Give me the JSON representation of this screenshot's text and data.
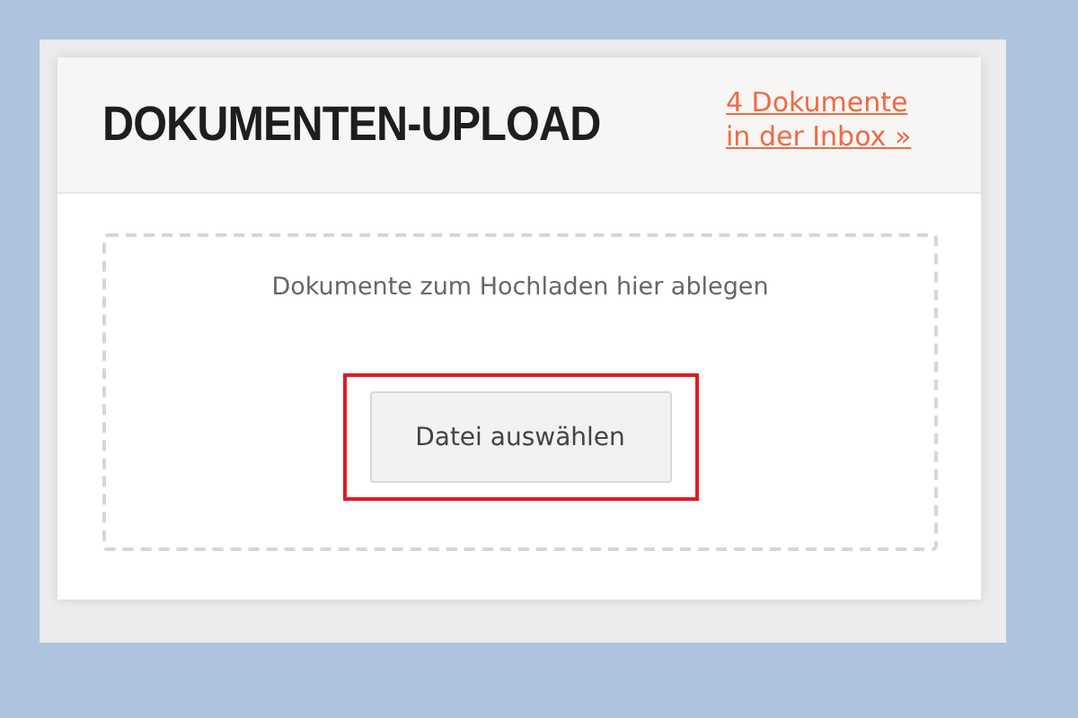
{
  "card": {
    "title": "DOKUMENTEN-UPLOAD",
    "inbox_link": "4 Dokumente in der Inbox »",
    "dropzone": {
      "hint": "Dokumente zum Hochladen hier ablegen",
      "button": {
        "label": "Datei auswählen",
        "highlighted": true
      }
    }
  }
}
